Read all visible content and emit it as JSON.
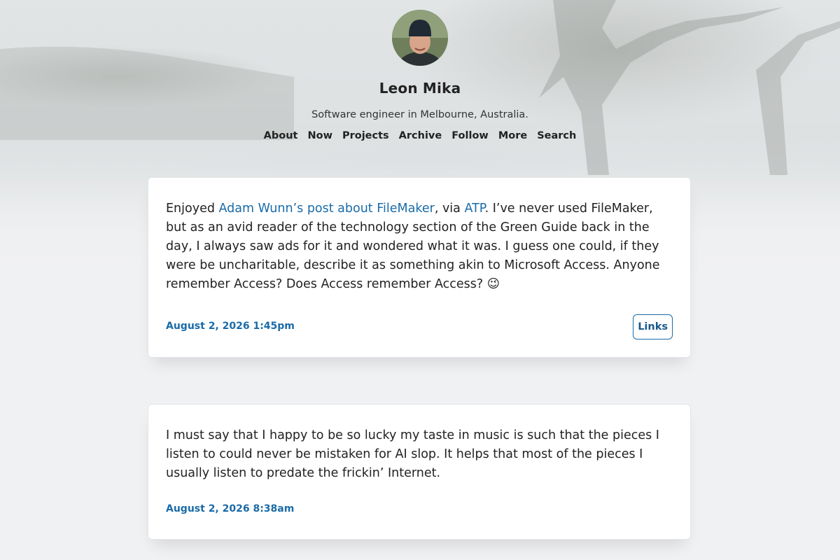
{
  "site": {
    "title": "Leon Mika",
    "tagline": "Software engineer in Melbourne, Australia."
  },
  "nav": {
    "items": [
      "About",
      "Now",
      "Projects",
      "Archive",
      "Follow",
      "More",
      "Search"
    ]
  },
  "posts": [
    {
      "text_before_link1": "Enjoyed ",
      "link1": "Adam Wunn’s post about FileMaker",
      "text_between": ", via ",
      "link2": "ATP",
      "text_after": ". I’ve never used FileMaker, but as an avid reader of the technology section of the Green Guide back in the day, I always saw ads for it and wondered what it was. I guess one could, if they were be uncharitable, describe it as something akin to Microsoft Access. Anyone remember Access? Does Access remember Access? 😉",
      "date": "August 2, 2026 1:45pm",
      "tag": "Links"
    },
    {
      "text": "I must say that I happy to be so lucky my taste in music is such that the pieces I listen to could never be mistaken for AI slop. It helps that most of the pieces I usually listen to predate the frickin’ Internet.",
      "date": "August 2, 2026 8:38am"
    }
  ],
  "colors": {
    "link": "#1a6ba8",
    "background": "#f0f1f3"
  }
}
